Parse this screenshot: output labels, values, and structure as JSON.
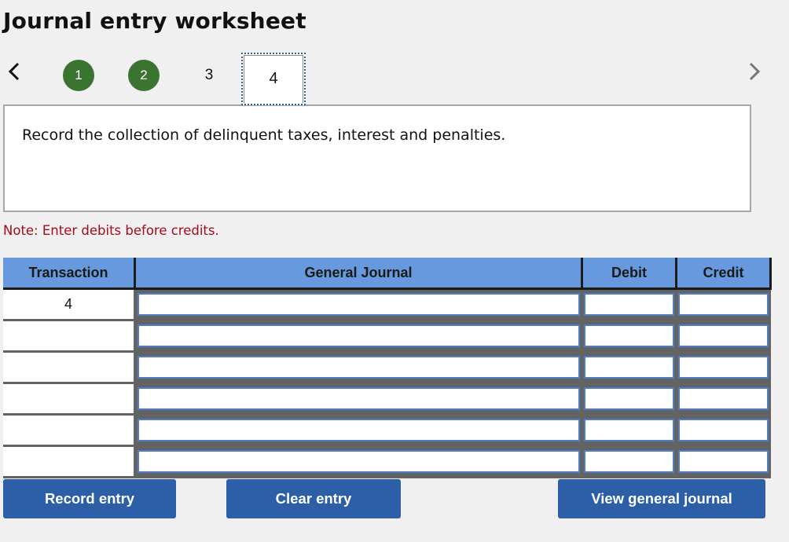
{
  "header": {
    "title": "Journal entry worksheet"
  },
  "navigation": {
    "prev_icon": "chevron-left-icon",
    "next_icon": "chevron-right-icon",
    "steps": [
      {
        "label": "1",
        "state": "completed"
      },
      {
        "label": "2",
        "state": "completed"
      },
      {
        "label": "3",
        "state": "pending"
      },
      {
        "label": "4",
        "state": "active"
      }
    ]
  },
  "prompt": {
    "text": "Record the collection of delinquent taxes, interest and penalties."
  },
  "note": {
    "text": "Note: Enter debits before credits."
  },
  "journal_table": {
    "columns": [
      "Transaction",
      "General Journal",
      "Debit",
      "Credit"
    ],
    "rows": [
      {
        "transaction": "4",
        "account": "",
        "debit": "",
        "credit": ""
      },
      {
        "transaction": "",
        "account": "",
        "debit": "",
        "credit": ""
      },
      {
        "transaction": "",
        "account": "",
        "debit": "",
        "credit": ""
      },
      {
        "transaction": "",
        "account": "",
        "debit": "",
        "credit": ""
      },
      {
        "transaction": "",
        "account": "",
        "debit": "",
        "credit": ""
      },
      {
        "transaction": "",
        "account": "",
        "debit": "",
        "credit": ""
      }
    ]
  },
  "buttons": {
    "record": "Record entry",
    "clear": "Clear entry",
    "view": "View general journal"
  },
  "colors": {
    "completed_step": "#3b7431",
    "header_bg": "#6699dd",
    "button_bg": "#2d5fa8",
    "note_text": "#a40b1b"
  }
}
